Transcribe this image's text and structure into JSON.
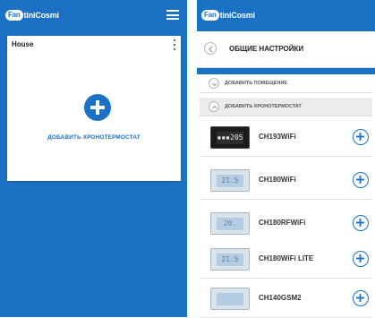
{
  "colors": {
    "brand_blue": "#1b72c4",
    "card_background": "#ffffff",
    "section_gray": "#ececec"
  },
  "left_screen": {
    "logo": {
      "badge": "Fan",
      "text": "tiniCosmi"
    },
    "menu_icon": "hamburger-menu-icon",
    "card": {
      "title": "House",
      "more_icon": "kebab-menu-icon",
      "add_icon": "plus-circle-icon",
      "add_label": "ДОБАВИТЬ ХРОНОТЕРМОСТАТ"
    }
  },
  "right_screen": {
    "logo": {
      "badge": "Fan",
      "text": "tiniCosmi"
    },
    "header": {
      "back_icon": "chevron-left-icon",
      "title": "ОБЩИЕ НАСТРОЙКИ"
    },
    "sections": [
      {
        "label": "ДОБАВИТЬ ПОМЕЩЕНИЕ",
        "icon": "chevron-down-icon"
      },
      {
        "label": "ДОБАВИТЬ ХРОНОТЕРМОСТАТ",
        "icon": "chevron-up-icon"
      }
    ],
    "devices": [
      {
        "name": "CH193WiFi",
        "display": "▪▪▪205",
        "style": "dark",
        "add_icon": "plus-circle-icon"
      },
      {
        "name": "CH180WiFi",
        "display": "21.5",
        "style": "light",
        "add_icon": "plus-circle-icon"
      },
      {
        "name": "CH180RFWiFi",
        "display": "20.",
        "style": "light",
        "add_icon": "plus-circle-icon"
      },
      {
        "name": "CH180WiFi LITE",
        "display": "21.5",
        "style": "light",
        "add_icon": "plus-circle-icon"
      },
      {
        "name": "CH140GSM2",
        "display": "",
        "style": "light",
        "add_icon": "plus-circle-icon"
      }
    ]
  }
}
